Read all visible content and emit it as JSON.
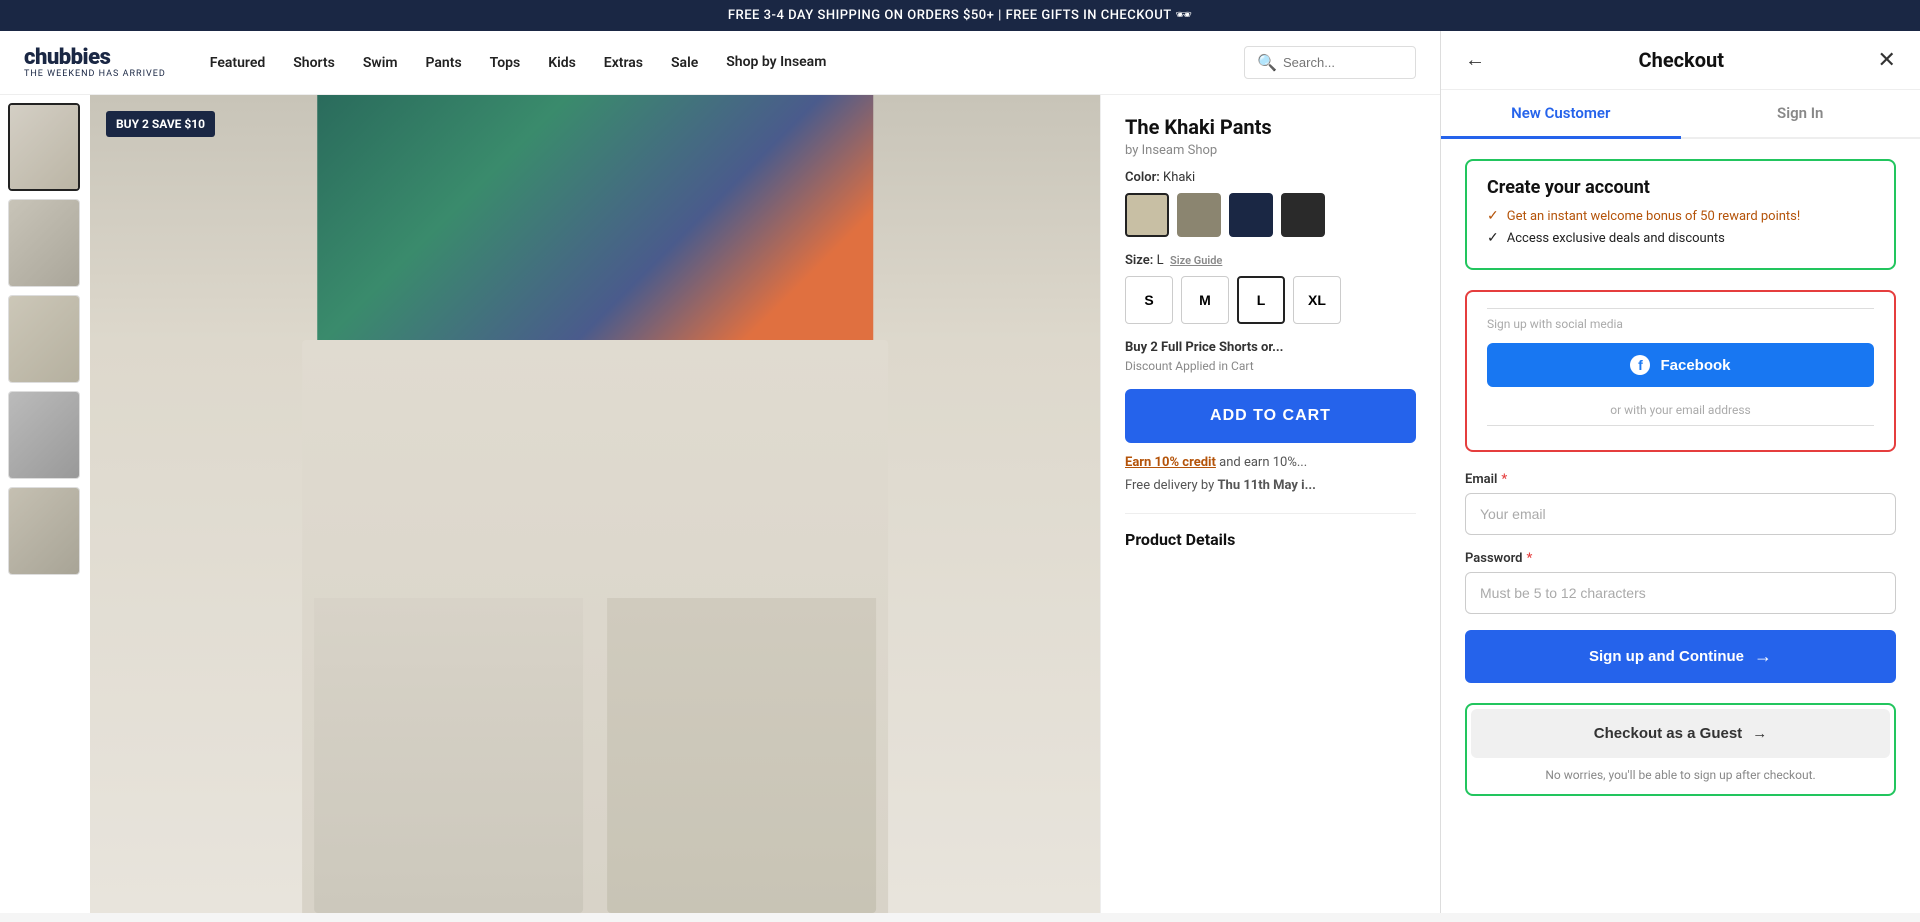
{
  "banner": {
    "text": "FREE 3-4 DAY SHIPPING ON ORDERS $50+ | FREE GIFTS IN CHECKOUT 🕶"
  },
  "nav": {
    "logo_text": "chubbies",
    "logo_sub": "THE WEEKEND HAS ARRIVED",
    "links": [
      "Featured",
      "Shorts",
      "Swim",
      "Pants",
      "Tops",
      "Kids",
      "Extras",
      "Sale"
    ],
    "shop_by_inseam": "Shop by Inseam",
    "search_placeholder": "Search..."
  },
  "product": {
    "badge": "BUY 2 SAVE $10",
    "name": "The Khaki Pants",
    "by": "by Inseam Shop",
    "color_label": "Color:",
    "color_value": "Khaki",
    "swatches": [
      {
        "id": "khaki",
        "bg": "#c8bfa4",
        "active": true
      },
      {
        "id": "olive",
        "bg": "#8b8570",
        "active": false
      },
      {
        "id": "navy",
        "bg": "#1a2744",
        "active": false
      },
      {
        "id": "black",
        "bg": "#2a2a2a",
        "active": false
      }
    ],
    "size_label": "Size:",
    "size_value": "L",
    "size_guide": "Size Guide",
    "sizes": [
      "S",
      "M",
      "L",
      "XL"
    ],
    "active_size": "L",
    "buy_promo": "Buy 2 Full Price Shorts or...",
    "discount_note": "Discount Applied in Cart",
    "add_to_cart": "ADD TO CART",
    "earn_credit_link": "Earn 10% credit",
    "earn_credit_text": " and earn 10%...",
    "free_delivery": "Free delivery by ",
    "delivery_date": "Thu 11th May i...",
    "product_details_heading": "Product Details"
  },
  "checkout": {
    "title": "Checkout",
    "back_label": "←",
    "close_label": "✕",
    "tabs": [
      {
        "id": "new-customer",
        "label": "New Customer",
        "active": true
      },
      {
        "id": "sign-in",
        "label": "Sign In",
        "active": false
      }
    ],
    "create_account": {
      "title": "Create your account",
      "benefits": [
        {
          "text": "Get an instant welcome bonus of 50 reward points!",
          "style": "gold"
        },
        {
          "text": "Access exclusive deals and discounts",
          "style": "black"
        }
      ]
    },
    "social_section": {
      "label": "Sign up with social media",
      "facebook_label": "Facebook"
    },
    "or_divider": "or with your email address",
    "email_label": "Email",
    "email_placeholder": "Your email",
    "password_label": "Password",
    "password_placeholder": "Must be 5 to 12 characters",
    "signup_button": "Sign up and Continue",
    "guest": {
      "button": "Checkout as a Guest",
      "note": "No worries, you'll be able to sign up after checkout."
    }
  }
}
